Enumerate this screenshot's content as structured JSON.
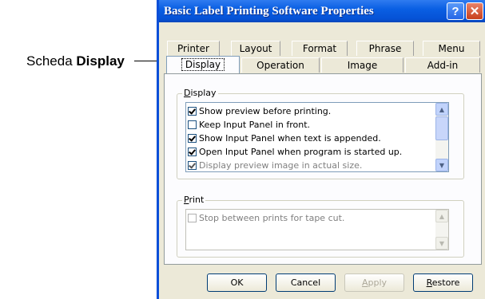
{
  "callout": {
    "prefix": "Scheda ",
    "bold": "Display"
  },
  "window": {
    "title": "Basic Label Printing Software Properties",
    "help_glyph": "?",
    "close_glyph": "✕"
  },
  "tabs": {
    "row_top": [
      "Printer",
      "Layout",
      "Format",
      "Phrase",
      "Menu"
    ],
    "row_bottom": [
      "Display",
      "Operation",
      "Image",
      "Add-in"
    ],
    "active": "Display"
  },
  "display_group": {
    "title_first": "D",
    "title_rest": "isplay",
    "items": [
      {
        "label": "Show preview before printing.",
        "checked": true,
        "enabled": true
      },
      {
        "label": "Keep Input Panel in front.",
        "checked": false,
        "enabled": true
      },
      {
        "label": "Show Input Panel when text is appended.",
        "checked": true,
        "enabled": true
      },
      {
        "label": "Open Input Panel when program is started up.",
        "checked": true,
        "enabled": true
      },
      {
        "label": "Display preview image in actual size.",
        "checked": true,
        "enabled": false
      }
    ]
  },
  "print_group": {
    "title_first": "P",
    "title_rest": "rint",
    "items": [
      {
        "label": "Stop between prints for tape cut.",
        "checked": false,
        "enabled": false
      }
    ]
  },
  "buttons": {
    "ok": "OK",
    "cancel": "Cancel",
    "apply_first": "A",
    "apply_rest": "pply",
    "restore_first": "R",
    "restore_rest": "estore"
  }
}
